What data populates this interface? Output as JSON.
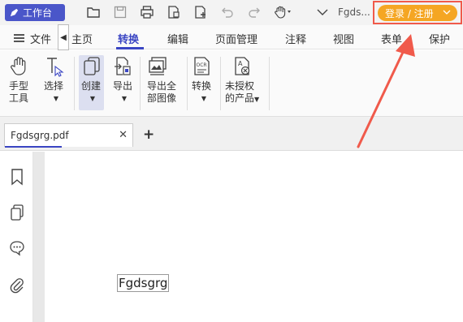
{
  "titlebar": {
    "workbench_label": "工作台",
    "doc_name": "Fgds...",
    "login_label": "登录 / 注册"
  },
  "menubar": {
    "file_label": "文件",
    "items": [
      "主页",
      "转换",
      "编辑",
      "页面管理",
      "注释",
      "视图",
      "表单",
      "保护"
    ],
    "active": "转换"
  },
  "ribbon": {
    "hand_tool": "手型\n工具",
    "select": "选择",
    "create": "创建",
    "export": "导出",
    "export_all_images": "导出全\n部图像",
    "convert": "转换",
    "unlicensed_products": "未授权\n的产品"
  },
  "tabs": {
    "file_name": "Fgdsgrg.pdf",
    "add_label": "+"
  },
  "document": {
    "text": "Fgdsgrg"
  },
  "colors": {
    "accent": "#3a45c3",
    "workbench_bg": "#4a56c9",
    "login_bg": "#f5a623",
    "highlight_red": "#f05a4b"
  }
}
